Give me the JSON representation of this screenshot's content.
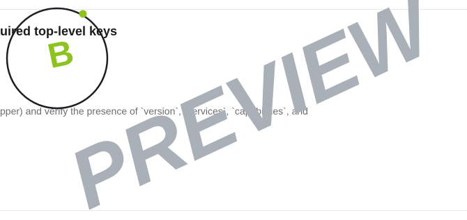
{
  "section": {
    "heading": "uired top-level keys",
    "description": "pper) and verify the presence of `version`, `services`, `capabilities`, and"
  },
  "logo": {
    "letter": "B",
    "ring_color": "#1c1f24",
    "accent_color": "#8dc21f"
  },
  "watermark": {
    "text": "PREVIEW",
    "color": "#aab0b8"
  }
}
